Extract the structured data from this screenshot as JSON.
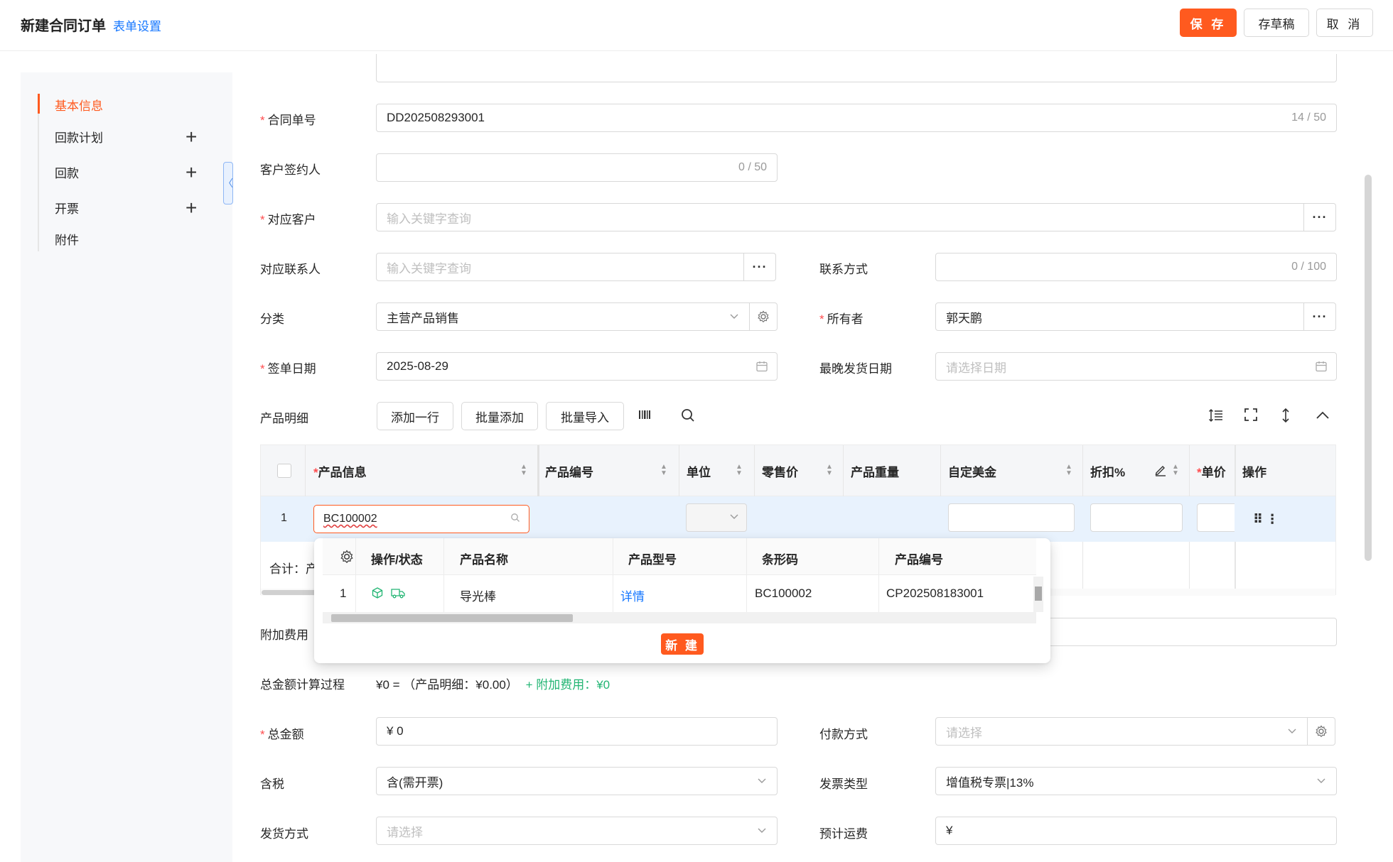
{
  "header": {
    "title": "新建合同订单",
    "form_settings": "表单设置",
    "save": "保 存",
    "draft": "存草稿",
    "cancel": "取 消"
  },
  "sidebar": {
    "items": [
      {
        "label": "基本信息",
        "active": true
      },
      {
        "label": "回款计划",
        "has_add": true
      },
      {
        "label": "回款",
        "has_add": true
      },
      {
        "label": "开票",
        "has_add": true
      },
      {
        "label": "附件"
      }
    ],
    "collapse_glyph": "〈"
  },
  "form": {
    "contract_no": {
      "label": "合同单号",
      "value": "DD202508293001",
      "count": "14 / 50"
    },
    "customer_signer": {
      "label": "客户签约人",
      "count": "0 / 50"
    },
    "customer": {
      "label": "对应客户",
      "placeholder": "输入关键字查询"
    },
    "contact": {
      "label": "对应联系人",
      "placeholder": "输入关键字查询"
    },
    "contact_method": {
      "label": "联系方式",
      "count": "0 / 100"
    },
    "category": {
      "label": "分类",
      "value": "主营产品销售"
    },
    "owner": {
      "label": "所有者",
      "value": "郭天鹏"
    },
    "sign_date": {
      "label": "签单日期",
      "value": "2025-08-29"
    },
    "latest_ship": {
      "label": "最晚发货日期",
      "placeholder": "请选择日期"
    },
    "product_detail": {
      "label": "产品明细"
    },
    "extra_fee": {
      "label": "附加费用"
    },
    "calc_process": {
      "label": "总金额计算过程",
      "text": "¥0 = （产品明细：¥0.00）",
      "extra": "+ 附加费用：¥0"
    },
    "total": {
      "label": "总金额",
      "value": "¥ 0"
    },
    "payment": {
      "label": "付款方式",
      "placeholder": "请选择"
    },
    "tax": {
      "label": "含税",
      "value": "含(需开票)"
    },
    "invoice_type": {
      "label": "发票类型",
      "value": "增值税专票|13%"
    },
    "ship_method": {
      "label": "发货方式",
      "placeholder": "请选择"
    },
    "freight": {
      "label": "预计运费",
      "value": "¥"
    }
  },
  "toolbar": {
    "add_row": "添加一行",
    "batch_add": "批量添加",
    "batch_import": "批量导入"
  },
  "table": {
    "columns": [
      "产品信息",
      "产品编号",
      "单位",
      "零售价",
      "产品重量",
      "自定美金",
      "折扣%",
      "单价",
      "操作"
    ],
    "row": {
      "index": "1",
      "product_input": "BC100002"
    },
    "total_label": "合计：产"
  },
  "dropdown": {
    "columns": [
      "操作/状态",
      "产品名称",
      "产品型号",
      "条形码",
      "产品编号"
    ],
    "row": {
      "index": "1",
      "name": "导光棒",
      "detail": "详情",
      "model": "",
      "barcode": "BC100002",
      "code": "CP202508183001"
    },
    "new_button": "新 建"
  },
  "colors": {
    "accent": "#ff5a1f",
    "link": "#1677ff",
    "green": "#22b573",
    "required": "#ff4d4f"
  }
}
